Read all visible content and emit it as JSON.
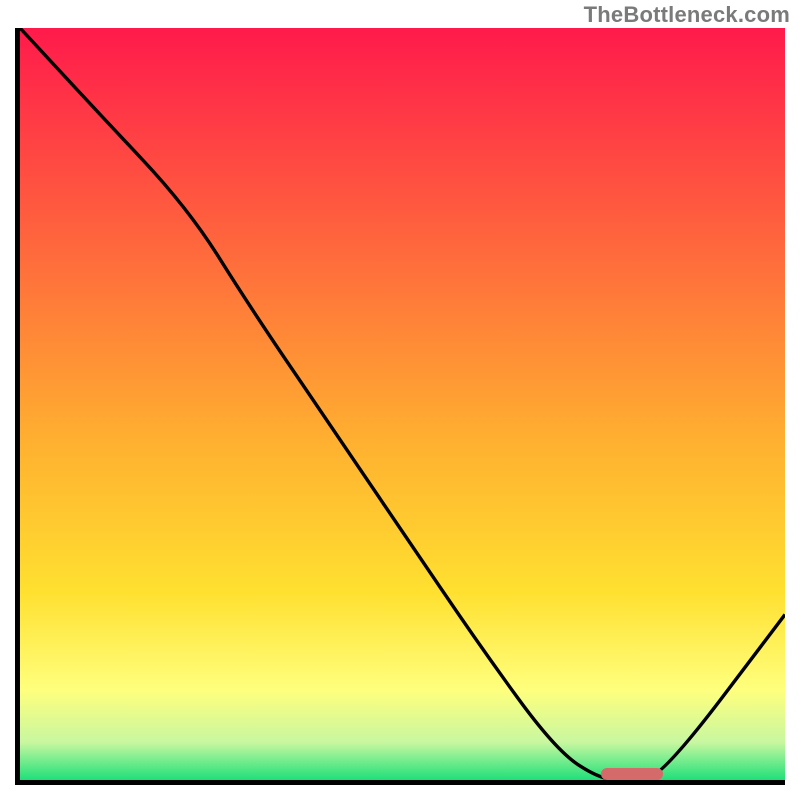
{
  "watermark": "TheBottleneck.com",
  "colors": {
    "gradient_top": "#ff1a4b",
    "gradient_mid1": "#ff6a3c",
    "gradient_mid2": "#ffb030",
    "gradient_mid3": "#ffe030",
    "gradient_yellowband": "#ffff7d",
    "gradient_palegreen": "#c8f7a0",
    "gradient_green": "#1fe07a",
    "curve": "#000000",
    "axis": "#000000",
    "marker": "#d46a6a"
  },
  "chart_data": {
    "type": "line",
    "title": "",
    "xlabel": "",
    "ylabel": "",
    "xlim": [
      0,
      100
    ],
    "ylim": [
      0,
      100
    ],
    "note": "No axis tick labels are shown; values are normalized 0-100 estimates read from the curve geometry.",
    "series": [
      {
        "name": "curve",
        "x": [
          0,
          10,
          22,
          30,
          40,
          50,
          60,
          70,
          76,
          80,
          84,
          100
        ],
        "y": [
          100,
          89,
          76,
          63,
          48,
          33,
          18,
          4,
          0,
          0,
          0.5,
          22
        ]
      }
    ],
    "marker": {
      "x_start": 76,
      "x_end": 84,
      "y": 0
    },
    "background_gradient_stops": [
      {
        "pos": 0.0,
        "label": "red"
      },
      {
        "pos": 0.3,
        "label": "orange"
      },
      {
        "pos": 0.55,
        "label": "amber"
      },
      {
        "pos": 0.75,
        "label": "yellow"
      },
      {
        "pos": 0.88,
        "label": "pale-yellow"
      },
      {
        "pos": 0.95,
        "label": "pale-green"
      },
      {
        "pos": 1.0,
        "label": "green"
      }
    ]
  }
}
